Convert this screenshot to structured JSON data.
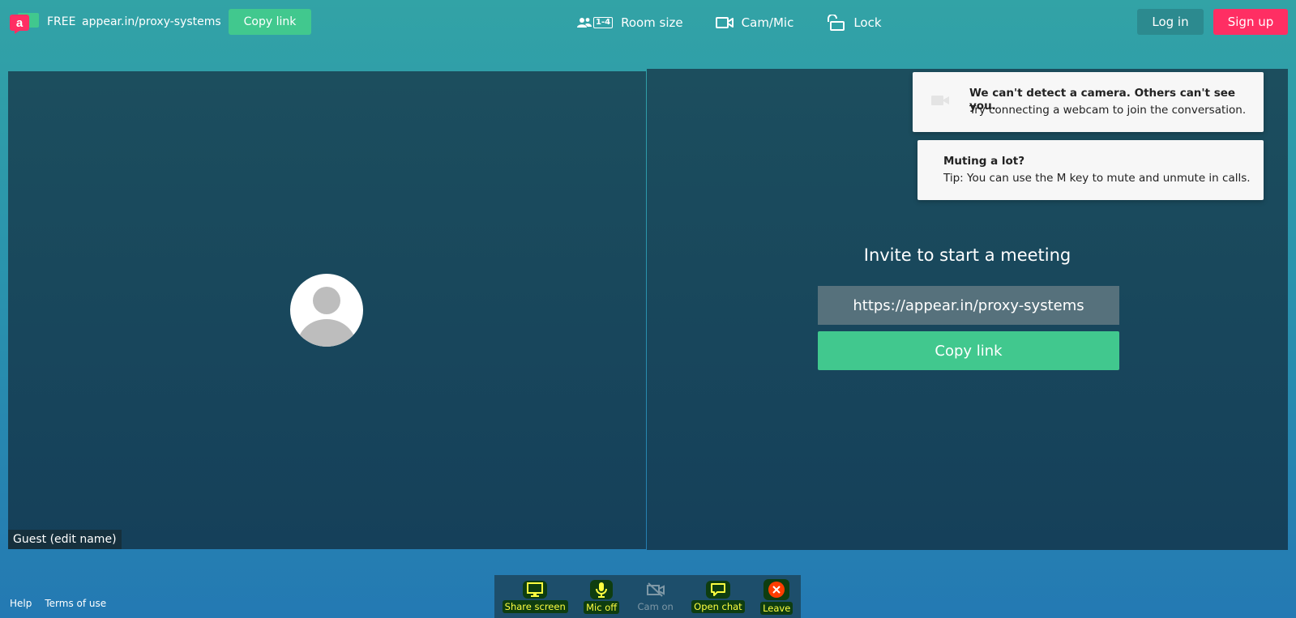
{
  "header": {
    "plan_label": "FREE",
    "room_url": "appear.in/proxy-systems",
    "copy_link_label": "Copy link",
    "room_size_badge": "1-4",
    "menu": [
      {
        "label": "Room size",
        "icon": "people-icon"
      },
      {
        "label": "Cam/Mic",
        "icon": "camera-icon"
      },
      {
        "label": "Lock",
        "icon": "lock-icon"
      }
    ],
    "login_label": "Log in",
    "signup_label": "Sign up"
  },
  "local_tile": {
    "name_label": "Guest (edit name)"
  },
  "invite": {
    "title": "Invite to start a meeting",
    "url": "https://appear.in/proxy-systems",
    "copy_link_label": "Copy link"
  },
  "notifications": [
    {
      "title": "We can't detect a camera. Others can't see you.",
      "body": "Try connecting a webcam to join the conversation."
    },
    {
      "title": "Muting a lot?",
      "body": "Tip: You can use the M key to mute and unmute in calls."
    }
  ],
  "toolbar": {
    "items": [
      {
        "label": "Share screen",
        "icon": "monitor-icon",
        "enabled": true
      },
      {
        "label": "Mic off",
        "icon": "microphone-icon",
        "enabled": true
      },
      {
        "label": "Cam on",
        "icon": "camera-off-icon",
        "enabled": false
      },
      {
        "label": "Open chat",
        "icon": "chat-icon",
        "enabled": true
      },
      {
        "label": "Leave",
        "icon": "close-circle-icon",
        "enabled": true
      }
    ]
  },
  "footer": {
    "help_label": "Help",
    "terms_label": "Terms of use"
  },
  "colors": {
    "brand_green": "#41c88e",
    "signup_pink": "#ff2e63",
    "tile_bg": "#1c4e5e",
    "toolbar_label": "#ffff40"
  }
}
